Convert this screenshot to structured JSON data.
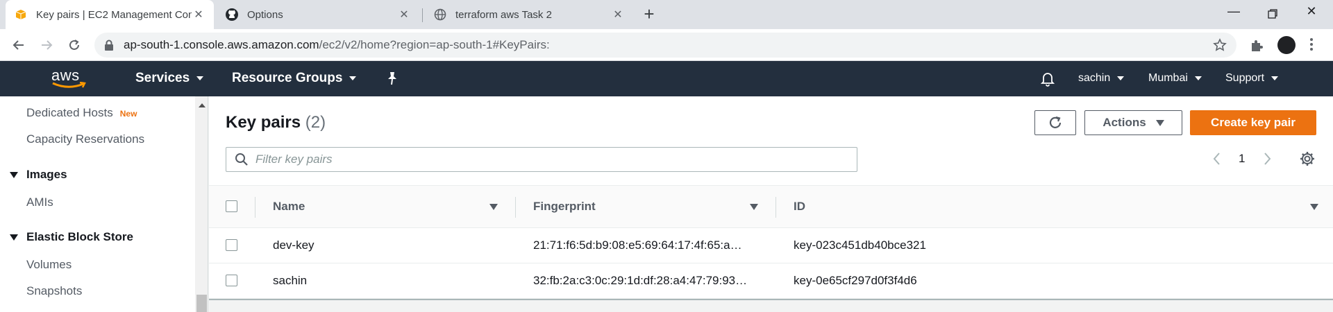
{
  "browser": {
    "tabs": [
      {
        "title": "Key pairs | EC2 Management Con",
        "favicon": "aws-box-icon",
        "active": true
      },
      {
        "title": "Options",
        "favicon": "github-icon",
        "active": false
      },
      {
        "title": "terraform aws Task 2",
        "favicon": "globe-icon",
        "active": false
      }
    ],
    "url_host": "ap-south-1.console.aws.amazon.com",
    "url_path": "/ec2/v2/home?region=ap-south-1#KeyPairs:"
  },
  "aws_nav": {
    "logo": "aws",
    "services": "Services",
    "resource_groups": "Resource Groups",
    "user": "sachin",
    "region": "Mumbai",
    "support": "Support"
  },
  "sidebar": {
    "dedicated_hosts": "Dedicated Hosts",
    "new_badge": "New",
    "capacity_reservations": "Capacity Reservations",
    "images_section": "Images",
    "amis": "AMIs",
    "ebs_section": "Elastic Block Store",
    "volumes": "Volumes",
    "snapshots": "Snapshots"
  },
  "main": {
    "title": "Key pairs",
    "count": "(2)",
    "actions_label": "Actions",
    "create_label": "Create key pair",
    "filter_placeholder": "Filter key pairs",
    "page_number": "1",
    "columns": [
      "Name",
      "Fingerprint",
      "ID"
    ],
    "rows": [
      {
        "name": "dev-key",
        "fingerprint": "21:71:f6:5d:b9:08:e5:69:64:17:4f:65:a…",
        "id": "key-023c451db40bce321"
      },
      {
        "name": "sachin",
        "fingerprint": "32:fb:2a:c3:0c:29:1d:df:28:a4:47:79:93…",
        "id": "key-0e65cf297d0f3f4d6"
      }
    ]
  },
  "colors": {
    "aws_nav_bg": "#232f3e",
    "primary_button": "#ec7211",
    "new_badge": "#ec7211"
  }
}
